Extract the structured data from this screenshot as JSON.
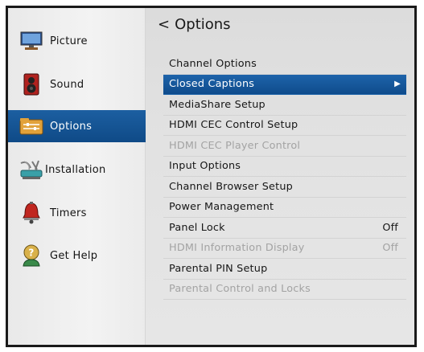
{
  "sidebar": {
    "items": [
      {
        "label": "Picture",
        "icon": "monitor-icon"
      },
      {
        "label": "Sound",
        "icon": "speaker-icon"
      },
      {
        "label": "Options",
        "icon": "options-folder-icon"
      },
      {
        "label": "Installation",
        "icon": "antenna-dish-icon"
      },
      {
        "label": "Timers",
        "icon": "alarm-bell-icon"
      },
      {
        "label": "Get Help",
        "icon": "help-person-icon"
      }
    ],
    "active_index": 2
  },
  "main": {
    "header": {
      "back": "<",
      "title": "Options"
    },
    "menu": [
      {
        "label": "Channel Options",
        "value": "",
        "state": "normal"
      },
      {
        "label": "Closed Captions",
        "value": "",
        "state": "selected"
      },
      {
        "label": "MediaShare Setup",
        "value": "",
        "state": "normal"
      },
      {
        "label": "HDMI CEC Control Setup",
        "value": "",
        "state": "normal"
      },
      {
        "label": "HDMI CEC Player Control",
        "value": "",
        "state": "disabled"
      },
      {
        "label": "Input Options",
        "value": "",
        "state": "normal"
      },
      {
        "label": "Channel Browser Setup",
        "value": "",
        "state": "normal"
      },
      {
        "label": "Power Management",
        "value": "",
        "state": "normal"
      },
      {
        "label": "Panel Lock",
        "value": "Off",
        "state": "normal"
      },
      {
        "label": "HDMI Information Display",
        "value": "Off",
        "state": "disabled"
      },
      {
        "label": "Parental PIN Setup",
        "value": "",
        "state": "normal"
      },
      {
        "label": "Parental Control and Locks",
        "value": "",
        "state": "disabled"
      }
    ]
  },
  "colors": {
    "selection": "#1a5c9e",
    "disabled_text": "#a3a3a3",
    "text": "#161616"
  }
}
